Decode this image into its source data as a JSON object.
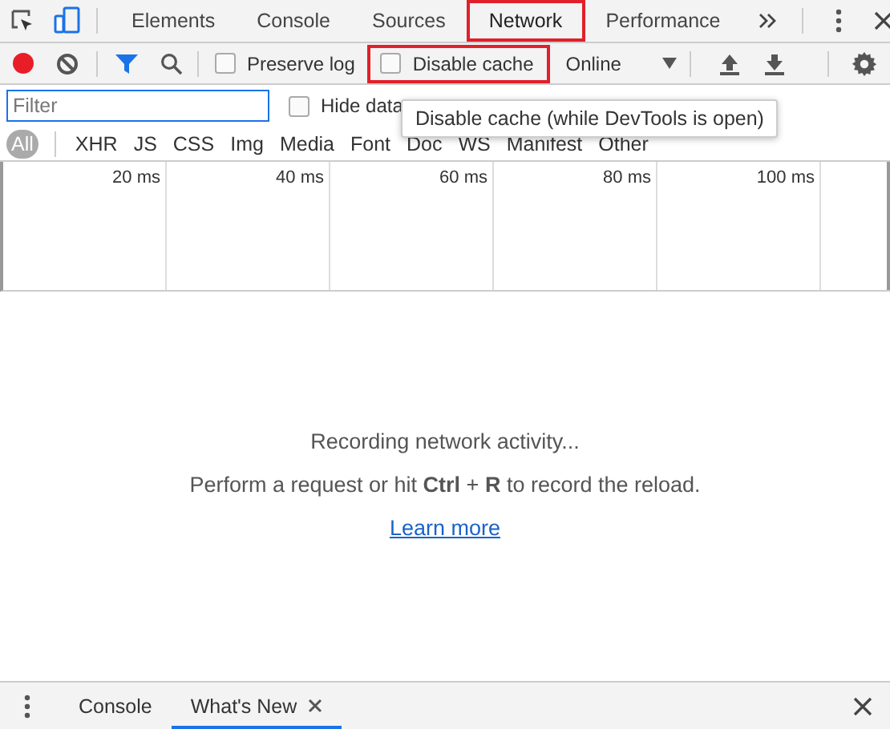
{
  "main_tabs": [
    {
      "label": "Elements",
      "selected": false,
      "highlighted": false
    },
    {
      "label": "Console",
      "selected": false,
      "highlighted": false
    },
    {
      "label": "Sources",
      "selected": false,
      "highlighted": false
    },
    {
      "label": "Network",
      "selected": true,
      "highlighted": true
    },
    {
      "label": "Performance",
      "selected": false,
      "highlighted": false
    }
  ],
  "toolbar": {
    "recording": true,
    "checkboxes": [
      {
        "label": "Preserve log",
        "checked": false,
        "highlighted": false
      },
      {
        "label": "Disable cache",
        "checked": false,
        "highlighted": true
      }
    ],
    "throttling": "Online"
  },
  "filter": {
    "placeholder": "Filter"
  },
  "hide_data_urls": {
    "label": "Hide data",
    "checked": false
  },
  "tooltip": "Disable cache (while DevTools is open)",
  "type_filters": [
    {
      "label": "All",
      "selected": true
    },
    {
      "label": "XHR",
      "selected": false
    },
    {
      "label": "JS",
      "selected": false
    },
    {
      "label": "CSS",
      "selected": false
    },
    {
      "label": "Img",
      "selected": false
    },
    {
      "label": "Media",
      "selected": false
    },
    {
      "label": "Font",
      "selected": false
    },
    {
      "label": "Doc",
      "selected": false
    },
    {
      "label": "WS",
      "selected": false
    },
    {
      "label": "Manifest",
      "selected": false
    },
    {
      "label": "Other",
      "selected": false
    }
  ],
  "timeline_ticks": [
    "20 ms",
    "40 ms",
    "60 ms",
    "80 ms",
    "100 ms"
  ],
  "empty_state": {
    "title": "Recording network activity...",
    "hint": "Perform a request or hit **Ctrl** + **R** to record the reload.",
    "link": "Learn more"
  },
  "drawer": {
    "tabs": [
      {
        "label": "Console",
        "selected": false,
        "closable": false
      },
      {
        "label": "What's New",
        "selected": true,
        "closable": true
      }
    ]
  }
}
